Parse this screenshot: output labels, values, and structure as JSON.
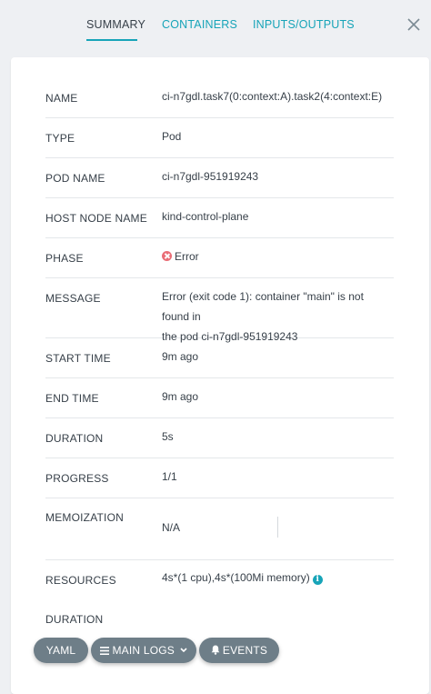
{
  "tabs": [
    {
      "label": "SUMMARY",
      "active": true
    },
    {
      "label": "CONTAINERS",
      "active": false
    },
    {
      "label": "INPUTS/OUTPUTS",
      "active": false
    }
  ],
  "close_icon": "close-icon",
  "summary": {
    "name": {
      "key": "NAME",
      "value": "ci-n7gdl.task7(0:context:A).task2(4:context:E)"
    },
    "type": {
      "key": "TYPE",
      "value": "Pod"
    },
    "pod_name": {
      "key": "POD NAME",
      "value": "ci-n7gdl-951919243"
    },
    "host_node_name": {
      "key": "HOST NODE NAME",
      "value": "kind-control-plane"
    },
    "phase": {
      "key": "PHASE",
      "value": "Error",
      "icon": "error-circle-icon",
      "color": "#e96d76"
    },
    "message": {
      "key": "MESSAGE",
      "value_line1": "Error (exit code 1): container \"main\" is not found in",
      "value_line2": "the pod ci-n7gdl-951919243"
    },
    "start_time": {
      "key": "START TIME",
      "value": "9m ago"
    },
    "end_time": {
      "key": "END TIME",
      "value": "9m ago"
    },
    "duration": {
      "key": "DURATION",
      "value": "5s"
    },
    "progress": {
      "key": "PROGRESS",
      "value": "1/1"
    },
    "memoization": {
      "key": "MEMOIZATION",
      "value": "N/A"
    },
    "resources": {
      "key": "RESOURCES",
      "value": "4s*(1 cpu),4s*(100Mi memory)",
      "icon": "info-icon"
    },
    "resources_duration": {
      "key": "DURATION"
    }
  },
  "actions": {
    "yaml": "YAML",
    "main_logs": "MAIN LOGS",
    "events": "EVENTS"
  },
  "colors": {
    "accent": "#17a4b8",
    "button": "#6e7e88",
    "text": "#363f48",
    "error": "#e96d76"
  }
}
